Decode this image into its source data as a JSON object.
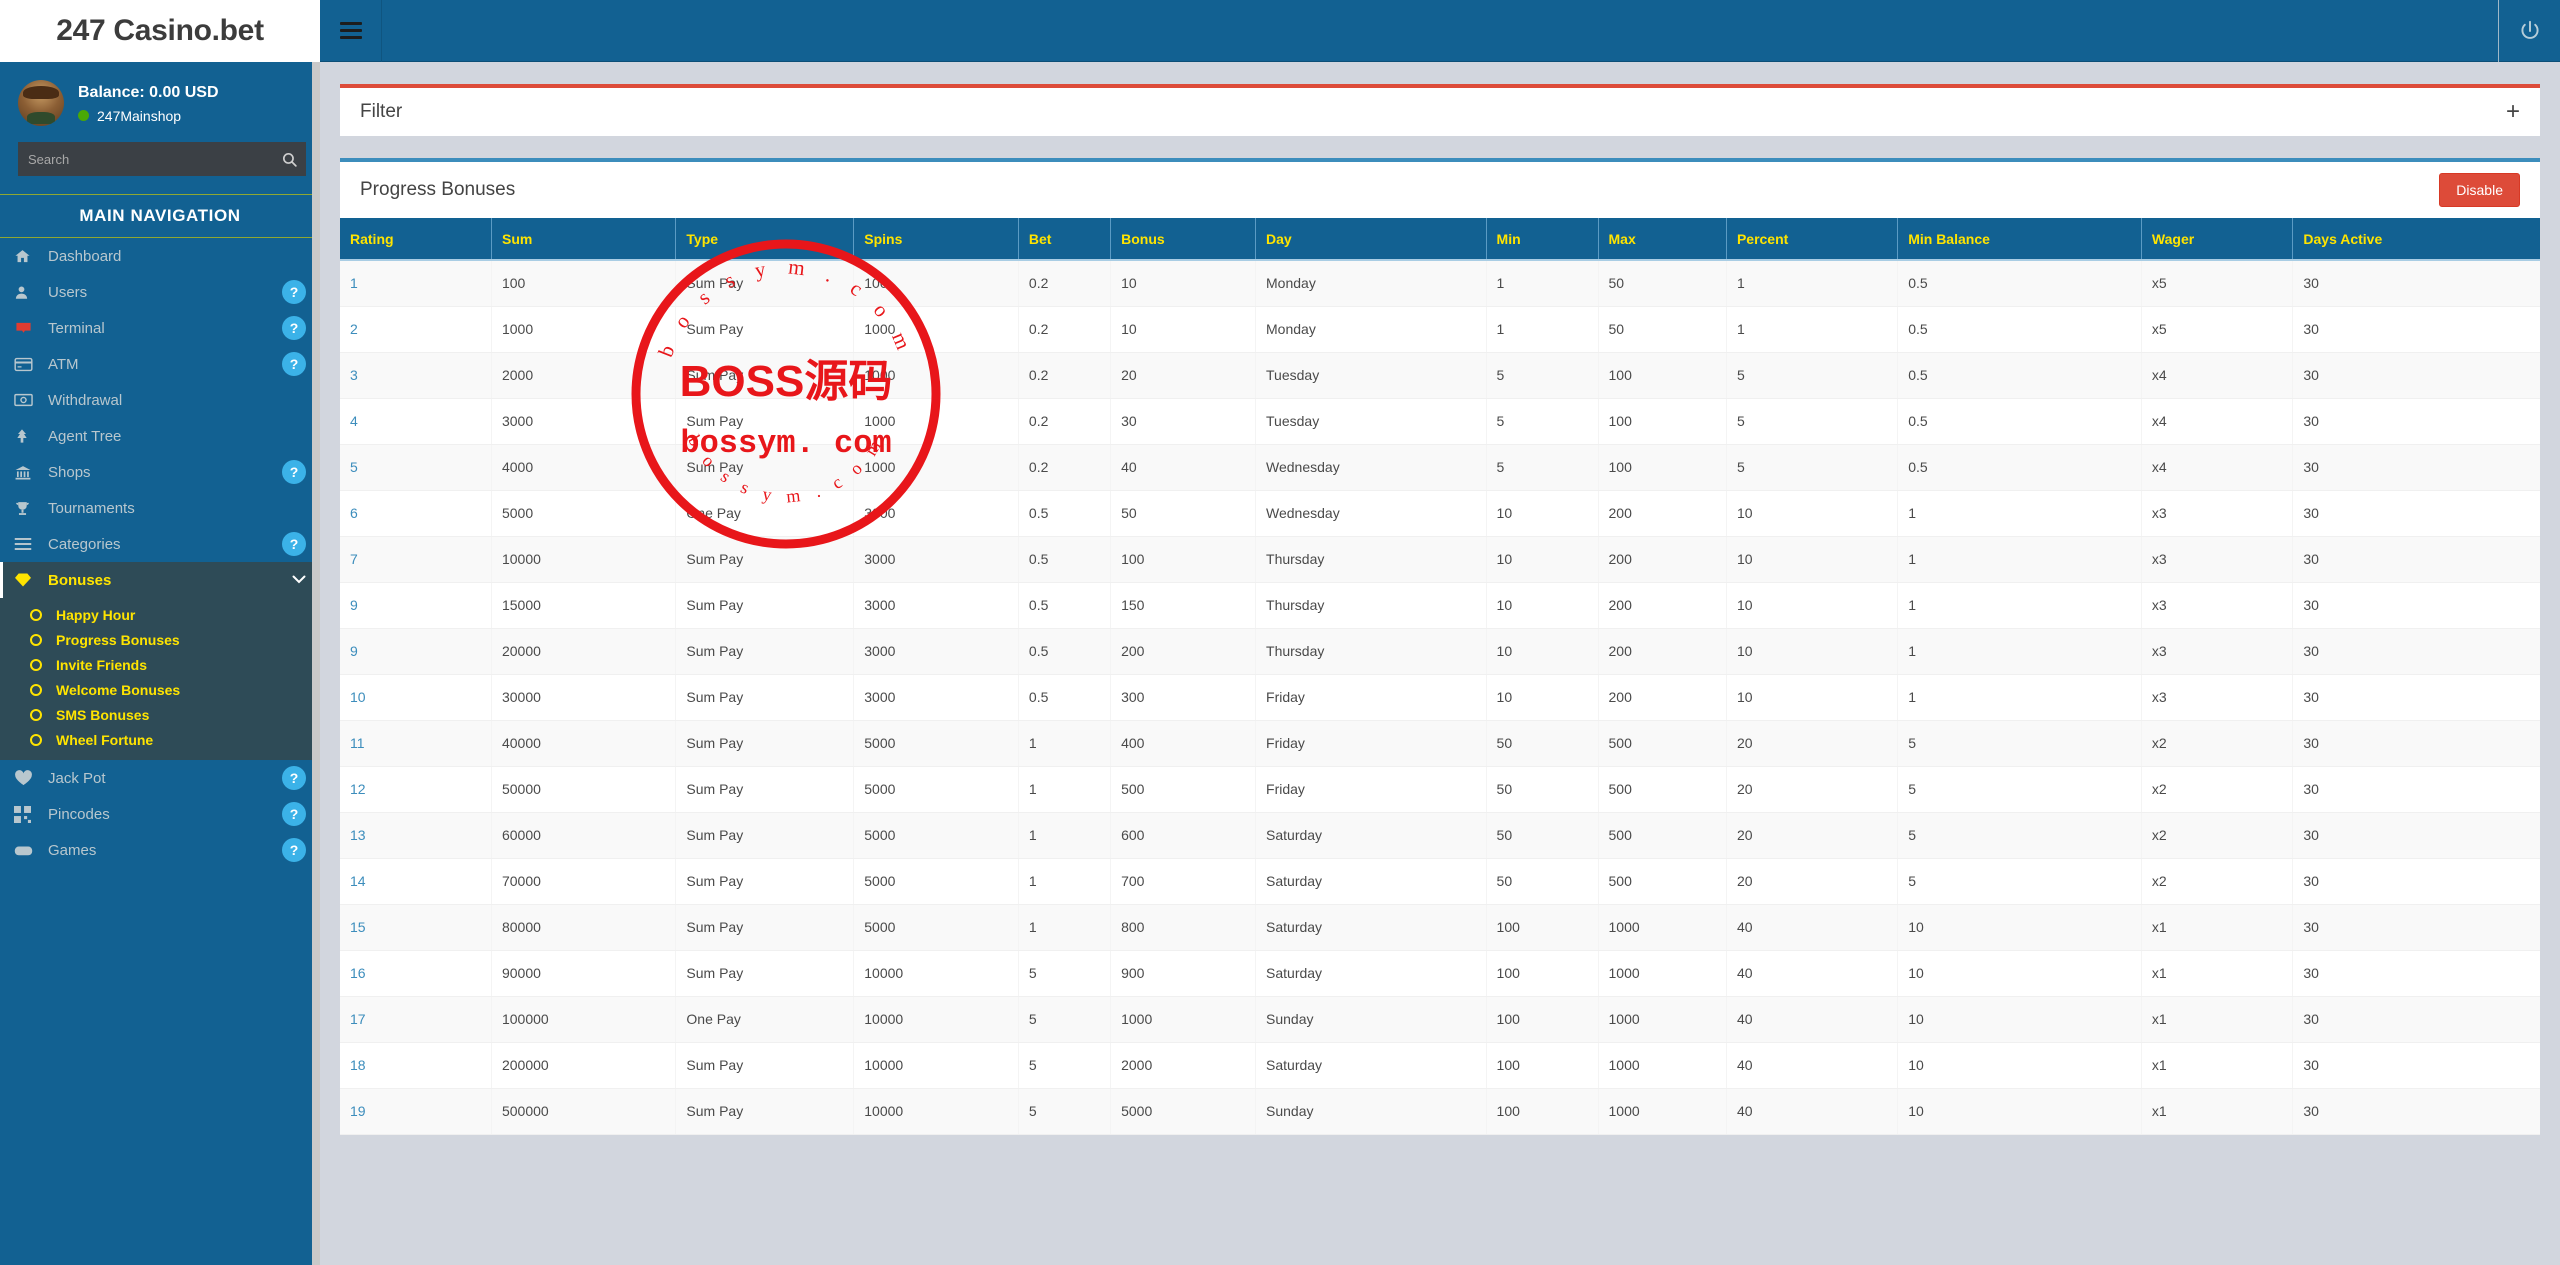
{
  "brand": {
    "logo_text": "247 Casino.bet"
  },
  "topbar": {
    "menu_icon": "hamburger-icon",
    "logout_icon": "power-icon"
  },
  "sidebar": {
    "balance_label": "Balance: 0.00 USD",
    "shop_name": "247Mainshop",
    "search": {
      "placeholder": "Search",
      "value": "",
      "icon": "search-icon"
    },
    "nav_header": "MAIN NAVIGATION",
    "items": [
      {
        "label": "Dashboard",
        "icon": "home-icon",
        "badge": ""
      },
      {
        "label": "Users",
        "icon": "user-icon",
        "badge": "?"
      },
      {
        "label": "Terminal",
        "icon": "terminal-icon",
        "badge": "?"
      },
      {
        "label": "ATM",
        "icon": "card-icon",
        "badge": "?"
      },
      {
        "label": "Withdrawal",
        "icon": "money-icon",
        "badge": ""
      },
      {
        "label": "Agent Tree",
        "icon": "tree-icon",
        "badge": ""
      },
      {
        "label": "Shops",
        "icon": "bank-icon",
        "badge": "?"
      },
      {
        "label": "Tournaments",
        "icon": "trophy-icon",
        "badge": ""
      },
      {
        "label": "Categories",
        "icon": "list-icon",
        "badge": "?"
      }
    ],
    "bonuses": {
      "label": "Bonuses",
      "icon": "gem-icon",
      "chevron": "chevron-down-icon",
      "submenu": [
        {
          "label": "Happy Hour"
        },
        {
          "label": "Progress Bonuses"
        },
        {
          "label": "Invite Friends"
        },
        {
          "label": "Welcome Bonuses"
        },
        {
          "label": "SMS Bonuses"
        },
        {
          "label": "Wheel Fortune"
        }
      ]
    },
    "items_after": [
      {
        "label": "Jack Pot",
        "icon": "heartbeat-icon",
        "badge": "?"
      },
      {
        "label": "Pincodes",
        "icon": "qr-icon",
        "badge": "?"
      },
      {
        "label": "Games",
        "icon": "gamepad-icon",
        "badge": "?"
      }
    ]
  },
  "filter_panel": {
    "title": "Filter",
    "expand_icon": "plus-icon"
  },
  "main": {
    "panel_title": "Progress Bonuses",
    "disable_label": "Disable",
    "columns": [
      "Rating",
      "Sum",
      "Type",
      "Spins",
      "Bet",
      "Bonus",
      "Day",
      "Min",
      "Max",
      "Percent",
      "Min Balance",
      "Wager",
      "Days Active"
    ],
    "rows": [
      [
        "1",
        "100",
        "Sum Pay",
        "100",
        "0.2",
        "10",
        "Monday",
        "1",
        "50",
        "1",
        "0.5",
        "x5",
        "30"
      ],
      [
        "2",
        "1000",
        "Sum Pay",
        "1000",
        "0.2",
        "10",
        "Monday",
        "1",
        "50",
        "1",
        "0.5",
        "x5",
        "30"
      ],
      [
        "3",
        "2000",
        "Sum Pay",
        "1000",
        "0.2",
        "20",
        "Tuesday",
        "5",
        "100",
        "5",
        "0.5",
        "x4",
        "30"
      ],
      [
        "4",
        "3000",
        "Sum Pay",
        "1000",
        "0.2",
        "30",
        "Tuesday",
        "5",
        "100",
        "5",
        "0.5",
        "x4",
        "30"
      ],
      [
        "5",
        "4000",
        "Sum Pay",
        "1000",
        "0.2",
        "40",
        "Wednesday",
        "5",
        "100",
        "5",
        "0.5",
        "x4",
        "30"
      ],
      [
        "6",
        "5000",
        "One Pay",
        "3000",
        "0.5",
        "50",
        "Wednesday",
        "10",
        "200",
        "10",
        "1",
        "x3",
        "30"
      ],
      [
        "7",
        "10000",
        "Sum Pay",
        "3000",
        "0.5",
        "100",
        "Thursday",
        "10",
        "200",
        "10",
        "1",
        "x3",
        "30"
      ],
      [
        "9",
        "15000",
        "Sum Pay",
        "3000",
        "0.5",
        "150",
        "Thursday",
        "10",
        "200",
        "10",
        "1",
        "x3",
        "30"
      ],
      [
        "9",
        "20000",
        "Sum Pay",
        "3000",
        "0.5",
        "200",
        "Thursday",
        "10",
        "200",
        "10",
        "1",
        "x3",
        "30"
      ],
      [
        "10",
        "30000",
        "Sum Pay",
        "3000",
        "0.5",
        "300",
        "Friday",
        "10",
        "200",
        "10",
        "1",
        "x3",
        "30"
      ],
      [
        "11",
        "40000",
        "Sum Pay",
        "5000",
        "1",
        "400",
        "Friday",
        "50",
        "500",
        "20",
        "5",
        "x2",
        "30"
      ],
      [
        "12",
        "50000",
        "Sum Pay",
        "5000",
        "1",
        "500",
        "Friday",
        "50",
        "500",
        "20",
        "5",
        "x2",
        "30"
      ],
      [
        "13",
        "60000",
        "Sum Pay",
        "5000",
        "1",
        "600",
        "Saturday",
        "50",
        "500",
        "20",
        "5",
        "x2",
        "30"
      ],
      [
        "14",
        "70000",
        "Sum Pay",
        "5000",
        "1",
        "700",
        "Saturday",
        "50",
        "500",
        "20",
        "5",
        "x2",
        "30"
      ],
      [
        "15",
        "80000",
        "Sum Pay",
        "5000",
        "1",
        "800",
        "Saturday",
        "100",
        "1000",
        "40",
        "10",
        "x1",
        "30"
      ],
      [
        "16",
        "90000",
        "Sum Pay",
        "10000",
        "5",
        "900",
        "Saturday",
        "100",
        "1000",
        "40",
        "10",
        "x1",
        "30"
      ],
      [
        "17",
        "100000",
        "One Pay",
        "10000",
        "5",
        "1000",
        "Sunday",
        "100",
        "1000",
        "40",
        "10",
        "x1",
        "30"
      ],
      [
        "18",
        "200000",
        "Sum Pay",
        "10000",
        "5",
        "2000",
        "Saturday",
        "100",
        "1000",
        "40",
        "10",
        "x1",
        "30"
      ],
      [
        "19",
        "500000",
        "Sum Pay",
        "10000",
        "5",
        "5000",
        "Sunday",
        "100",
        "1000",
        "40",
        "10",
        "x1",
        "30"
      ]
    ]
  },
  "watermark": {
    "center_text": "BOSS源码",
    "domain_text": "bossym. com",
    "ring_top_text": "b o s s y m . c o m",
    "ring_bottom_text": "b o s s y m . c o m",
    "color": "#e8161a"
  },
  "colors": {
    "sidebar": "#126192",
    "header_blue": "#126192",
    "accent_yellow": "#ffe400",
    "danger_red": "#dd4b39",
    "panel_blue": "#3c8dbc",
    "submenu_bg": "#2e4b57",
    "content_bg": "#d2d6de"
  }
}
